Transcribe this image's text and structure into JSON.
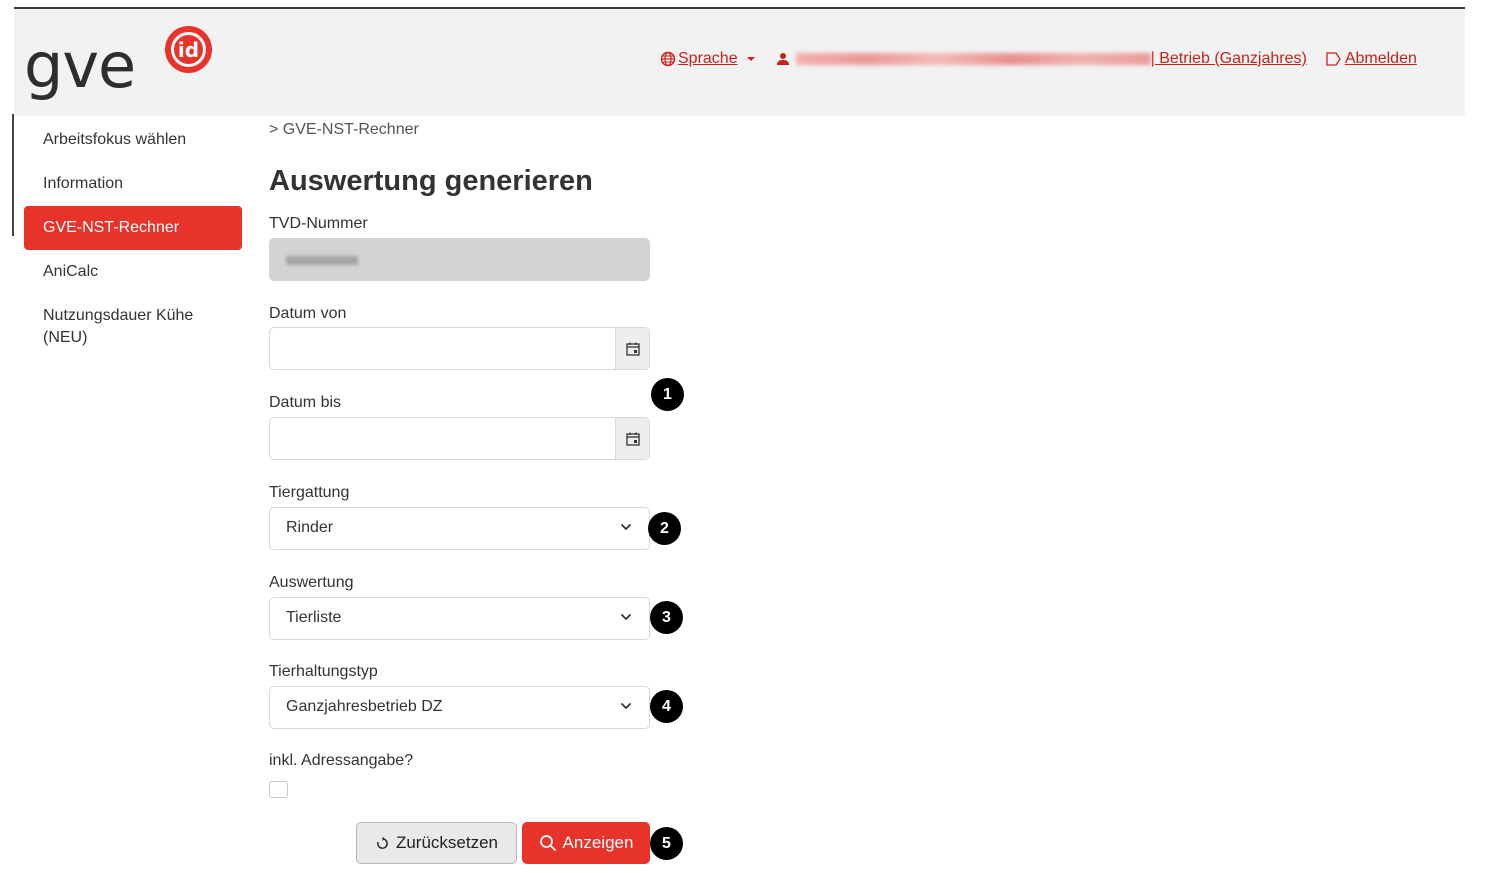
{
  "logo": {
    "text": "gve",
    "badge": "id"
  },
  "topnav": {
    "language_label": "Sprache",
    "business_label": "| Betrieb (Ganzjahres)",
    "logout_label": "Abmelden"
  },
  "sidebar": {
    "items": [
      {
        "label": "Arbeitsfokus wählen"
      },
      {
        "label": "Information"
      },
      {
        "label": "GVE-NST-Rechner"
      },
      {
        "label": "AniCalc"
      },
      {
        "label": "Nutzungsdauer Kühe (NEU)"
      }
    ]
  },
  "breadcrumb": "> GVE-NST-Rechner",
  "page_title": "Auswertung generieren",
  "form": {
    "tvd_label": "TVD-Nummer",
    "datum_von_label": "Datum von",
    "datum_von_value": "",
    "datum_bis_label": "Datum bis",
    "datum_bis_value": "",
    "tiergattung_label": "Tiergattung",
    "tiergattung_value": "Rinder",
    "auswertung_label": "Auswertung",
    "auswertung_value": "Tierliste",
    "tierhaltungstyp_label": "Tierhaltungstyp",
    "tierhaltungstyp_value": "Ganzjahresbetrieb DZ",
    "adresse_label": "inkl. Adressangabe?",
    "adresse_checked": false
  },
  "buttons": {
    "reset_label": "Zurücksetzen",
    "show_label": "Anzeigen"
  },
  "markers": [
    "1",
    "2",
    "3",
    "4",
    "5"
  ],
  "colors": {
    "accent": "#e8332b",
    "header_bg": "#f2f2f2"
  }
}
